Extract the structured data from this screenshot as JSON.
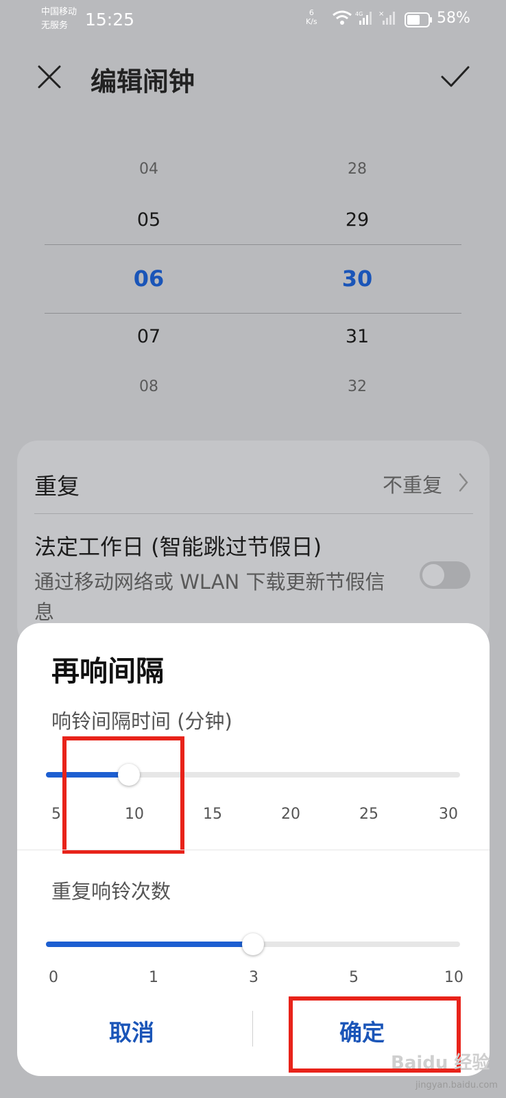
{
  "status_bar": {
    "carrier_line1": "中国移动",
    "carrier_line2": "无服务",
    "time": "15:25",
    "net_speed_value": "6",
    "net_speed_unit": "K/s",
    "battery": "58%"
  },
  "header": {
    "title": "编辑闹钟"
  },
  "time_picker": {
    "hours": [
      "04",
      "05",
      "06",
      "07",
      "08"
    ],
    "minutes": [
      "28",
      "29",
      "30",
      "31",
      "32"
    ],
    "selected_hour": "06",
    "selected_minute": "30"
  },
  "settings": {
    "repeat_label": "重复",
    "repeat_value": "不重复",
    "workday_label": "法定工作日 (智能跳过节假日)",
    "workday_desc": "通过移动网络或 WLAN 下载更新节假信息",
    "workday_enabled": false
  },
  "snooze_dialog": {
    "title": "再响间隔",
    "interval_label": "响铃间隔时间 (分钟)",
    "interval_ticks": [
      "5",
      "10",
      "15",
      "20",
      "25",
      "30"
    ],
    "interval_value": 10,
    "count_label": "重复响铃次数",
    "count_ticks": [
      "0",
      "1",
      "3",
      "5",
      "10"
    ],
    "count_value": 3,
    "cancel_label": "取消",
    "ok_label": "确定"
  },
  "watermark": {
    "text": "Baidu 经验",
    "sub": "jingyan.baidu.com"
  },
  "colors": {
    "accent": "#1a55b8",
    "slider_fill": "#1d5fd1",
    "highlight": "#e8231a"
  }
}
